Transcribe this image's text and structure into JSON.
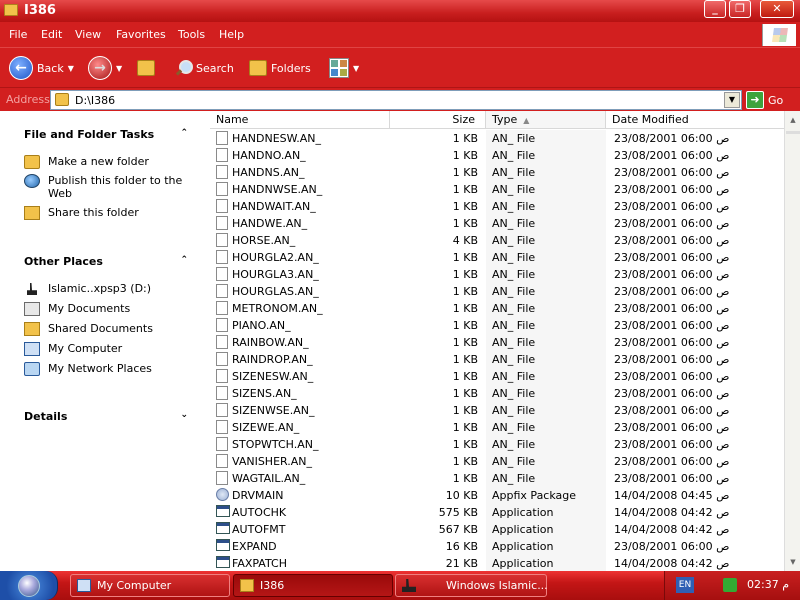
{
  "window": {
    "title": "I386"
  },
  "menu": [
    "File",
    "Edit",
    "View",
    "Favorites",
    "Tools",
    "Help"
  ],
  "toolbar": {
    "back_label": "Back",
    "search_label": "Search",
    "folders_label": "Folders"
  },
  "address": {
    "label": "Address",
    "value": "D:\\I386",
    "go_label": "Go"
  },
  "taskpane": {
    "file_tasks": {
      "title": "File and Folder Tasks",
      "items": [
        "Make a new folder",
        "Publish this folder to the Web",
        "Share this folder"
      ]
    },
    "other_places": {
      "title": "Other Places",
      "items": [
        "Islamic..xpsp3 (D:)",
        "My Documents",
        "Shared Documents",
        "My Computer",
        "My Network Places"
      ]
    },
    "details": {
      "title": "Details"
    }
  },
  "columns": {
    "name": "Name",
    "size": "Size",
    "type": "Type",
    "date": "Date Modified"
  },
  "files": [
    {
      "name": "HANDNESW.AN_",
      "size": "1 KB",
      "type": "AN_ File",
      "date": "23/08/2001 06:00 ص",
      "icon": "file"
    },
    {
      "name": "HANDNO.AN_",
      "size": "1 KB",
      "type": "AN_ File",
      "date": "23/08/2001 06:00 ص",
      "icon": "file"
    },
    {
      "name": "HANDNS.AN_",
      "size": "1 KB",
      "type": "AN_ File",
      "date": "23/08/2001 06:00 ص",
      "icon": "file"
    },
    {
      "name": "HANDNWSE.AN_",
      "size": "1 KB",
      "type": "AN_ File",
      "date": "23/08/2001 06:00 ص",
      "icon": "file"
    },
    {
      "name": "HANDWAIT.AN_",
      "size": "1 KB",
      "type": "AN_ File",
      "date": "23/08/2001 06:00 ص",
      "icon": "file"
    },
    {
      "name": "HANDWE.AN_",
      "size": "1 KB",
      "type": "AN_ File",
      "date": "23/08/2001 06:00 ص",
      "icon": "file"
    },
    {
      "name": "HORSE.AN_",
      "size": "4 KB",
      "type": "AN_ File",
      "date": "23/08/2001 06:00 ص",
      "icon": "file"
    },
    {
      "name": "HOURGLA2.AN_",
      "size": "1 KB",
      "type": "AN_ File",
      "date": "23/08/2001 06:00 ص",
      "icon": "file"
    },
    {
      "name": "HOURGLA3.AN_",
      "size": "1 KB",
      "type": "AN_ File",
      "date": "23/08/2001 06:00 ص",
      "icon": "file"
    },
    {
      "name": "HOURGLAS.AN_",
      "size": "1 KB",
      "type": "AN_ File",
      "date": "23/08/2001 06:00 ص",
      "icon": "file"
    },
    {
      "name": "METRONOM.AN_",
      "size": "1 KB",
      "type": "AN_ File",
      "date": "23/08/2001 06:00 ص",
      "icon": "file"
    },
    {
      "name": "PIANO.AN_",
      "size": "1 KB",
      "type": "AN_ File",
      "date": "23/08/2001 06:00 ص",
      "icon": "file"
    },
    {
      "name": "RAINBOW.AN_",
      "size": "1 KB",
      "type": "AN_ File",
      "date": "23/08/2001 06:00 ص",
      "icon": "file"
    },
    {
      "name": "RAINDROP.AN_",
      "size": "1 KB",
      "type": "AN_ File",
      "date": "23/08/2001 06:00 ص",
      "icon": "file"
    },
    {
      "name": "SIZENESW.AN_",
      "size": "1 KB",
      "type": "AN_ File",
      "date": "23/08/2001 06:00 ص",
      "icon": "file"
    },
    {
      "name": "SIZENS.AN_",
      "size": "1 KB",
      "type": "AN_ File",
      "date": "23/08/2001 06:00 ص",
      "icon": "file"
    },
    {
      "name": "SIZENWSE.AN_",
      "size": "1 KB",
      "type": "AN_ File",
      "date": "23/08/2001 06:00 ص",
      "icon": "file"
    },
    {
      "name": "SIZEWE.AN_",
      "size": "1 KB",
      "type": "AN_ File",
      "date": "23/08/2001 06:00 ص",
      "icon": "file"
    },
    {
      "name": "STOPWTCH.AN_",
      "size": "1 KB",
      "type": "AN_ File",
      "date": "23/08/2001 06:00 ص",
      "icon": "file"
    },
    {
      "name": "VANISHER.AN_",
      "size": "1 KB",
      "type": "AN_ File",
      "date": "23/08/2001 06:00 ص",
      "icon": "file"
    },
    {
      "name": "WAGTAIL.AN_",
      "size": "1 KB",
      "type": "AN_ File",
      "date": "23/08/2001 06:00 ص",
      "icon": "file"
    },
    {
      "name": "DRVMAIN",
      "size": "10 KB",
      "type": "Appfix Package",
      "date": "14/04/2008 04:45 ص",
      "icon": "pkg"
    },
    {
      "name": "AUTOCHK",
      "size": "575 KB",
      "type": "Application",
      "date": "14/04/2008 04:42 ص",
      "icon": "app"
    },
    {
      "name": "AUTOFMT",
      "size": "567 KB",
      "type": "Application",
      "date": "14/04/2008 04:42 ص",
      "icon": "app"
    },
    {
      "name": "EXPAND",
      "size": "16 KB",
      "type": "Application",
      "date": "23/08/2001 06:00 ص",
      "icon": "app"
    },
    {
      "name": "FAXPATCH",
      "size": "21 KB",
      "type": "Application",
      "date": "14/04/2008 04:42 ص",
      "icon": "app"
    }
  ],
  "taskbar": {
    "buttons": [
      {
        "label": "My Computer",
        "active": false
      },
      {
        "label": "I386",
        "active": true
      },
      {
        "label": "Windows Islamic...",
        "active": false
      }
    ],
    "lang": "EN",
    "clock": "02:37 م"
  },
  "colors": {
    "theme": "#d21f1f",
    "titlebar": "#c81e1e",
    "taskbar": "#c41616"
  }
}
